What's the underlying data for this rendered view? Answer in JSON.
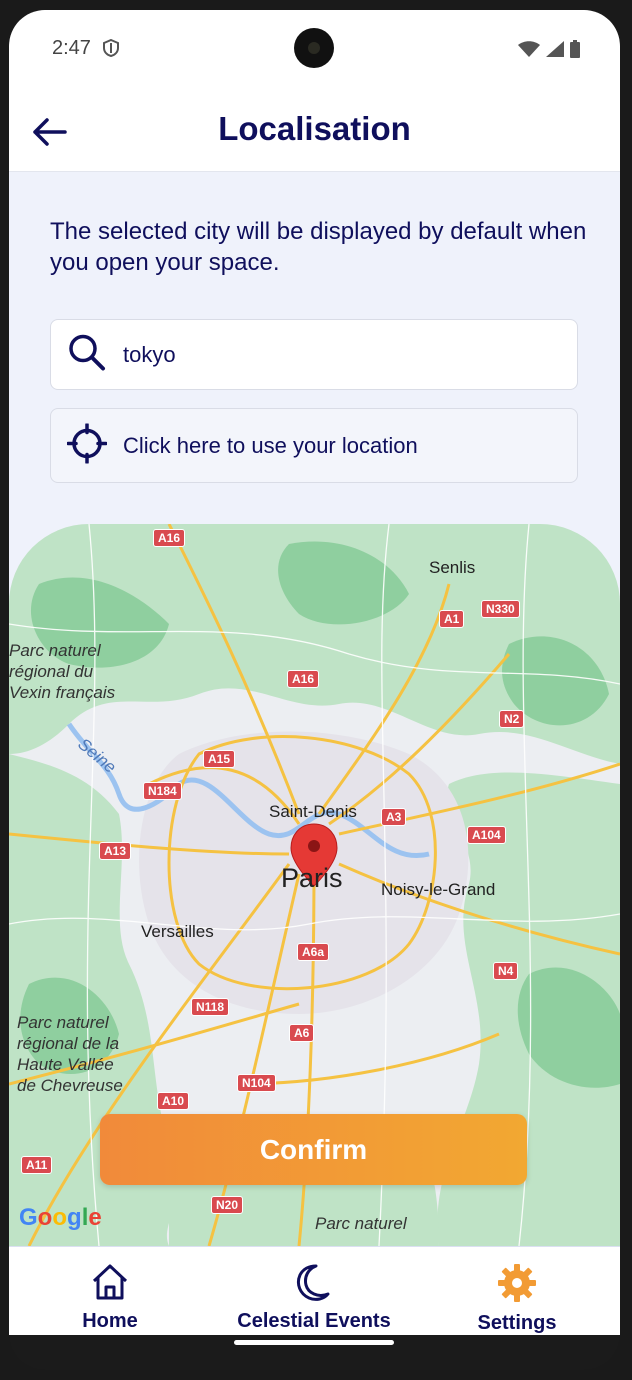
{
  "status_bar": {
    "time": "2:47"
  },
  "header": {
    "title": "Localisation"
  },
  "description": "The selected city will be displayed by default when you open your space.",
  "search": {
    "value": "tokyo"
  },
  "locate_button": {
    "label": "Click here to use your location"
  },
  "map": {
    "marker_city": "Paris",
    "labels": {
      "senlis": "Senlis",
      "saint_denis": "Saint-Denis",
      "noisy": "Noisy-le-Grand",
      "versailles": "Versailles",
      "seine": "Seine",
      "parc_vexin": "Parc naturel\nrégional du\nVexin français",
      "parc_chevreuse": "Parc naturel\nrégional de la\nHaute Vallée\nde Chevreuse",
      "parc_bottom": "Parc naturel"
    },
    "roads": [
      "A16",
      "A1",
      "N330",
      "A16",
      "N2",
      "A15",
      "N184",
      "A3",
      "A104",
      "A13",
      "A6a",
      "N4",
      "N118",
      "A6",
      "N104",
      "A10",
      "A11",
      "N20"
    ],
    "attribution": "Google"
  },
  "confirm_button": {
    "label": "Confirm"
  },
  "nav": {
    "home": "Home",
    "events": "Celestial Events",
    "settings": "Settings"
  },
  "colors": {
    "primary": "#0f0f5c",
    "accent": "#f29b34",
    "map_green": "#a9d9b4"
  }
}
